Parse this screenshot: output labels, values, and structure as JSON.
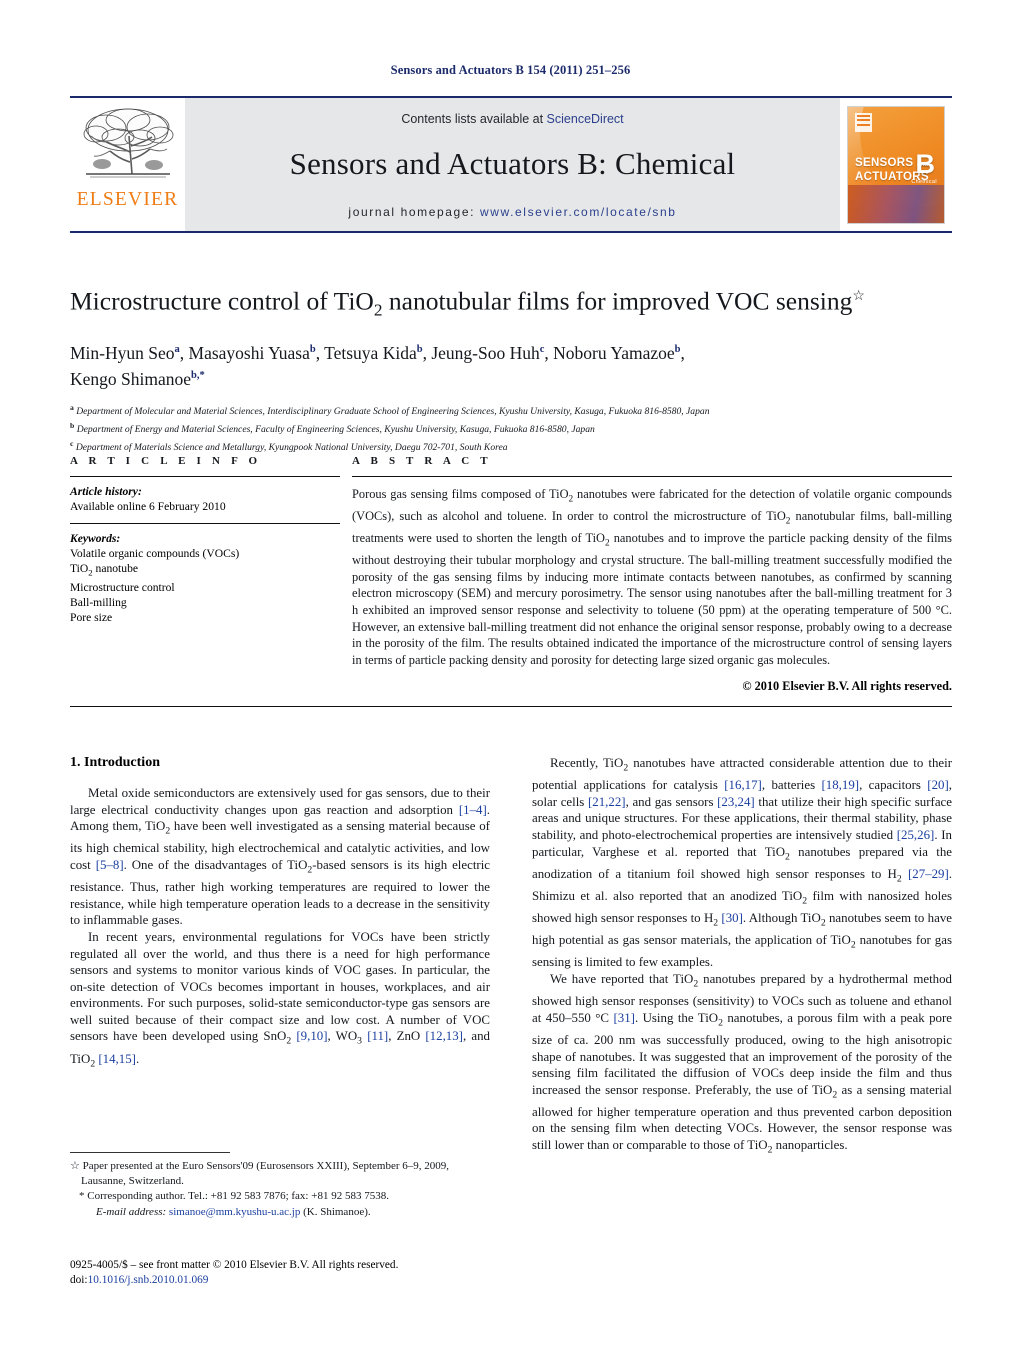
{
  "running_head": "Sensors and Actuators B 154 (2011) 251–256",
  "masthead": {
    "publisher_logo_word": "ELSEVIER",
    "contents_prefix": "Contents lists available at ",
    "contents_link": "ScienceDirect",
    "journal_title": "Sensors and Actuators B: Chemical",
    "homepage_prefix": "journal homepage: ",
    "homepage_url": "www.elsevier.com/locate/snb",
    "cover": {
      "line1": "SENSORS",
      "line1_small": "and",
      "line2": "ACTUATORS",
      "series_letter": "B",
      "series_sub": "Chemical"
    }
  },
  "title": {
    "main_part1": "Microstructure control of TiO",
    "main_sub": "2",
    "main_part2": " nanotubular films for improved VOC sensing",
    "footnote_marker": "☆"
  },
  "authors": {
    "line1": "Min-Hyun Seo a, Masayoshi Yuasa b, Tetsuya Kida b, Jeung-Soo Huh c, Noboru Yamazoe b,",
    "line2": "Kengo Shimanoe b,*"
  },
  "affiliations": [
    {
      "marker": "a",
      "text": "Department of Molecular and Material Sciences, Interdisciplinary Graduate School of Engineering Sciences, Kyushu University, Kasuga, Fukuoka 816-8580, Japan"
    },
    {
      "marker": "b",
      "text": "Department of Energy and Material Sciences, Faculty of Engineering Sciences, Kyushu University, Kasuga, Fukuoka 816-8580, Japan"
    },
    {
      "marker": "c",
      "text": "Department of Materials Science and Metallurgy, Kyungpook National University, Daegu 702-701, South Korea"
    }
  ],
  "article_info": {
    "heading": "A R T I C L E    I N F O",
    "history_label": "Article history:",
    "history_value": "Available online 6 February 2010",
    "keywords_label": "Keywords:",
    "keywords": [
      "Volatile organic compounds (VOCs)",
      "TiO2 nanotube",
      "Microstructure control",
      "Ball-milling",
      "Pore size"
    ]
  },
  "abstract": {
    "heading": "A B S T R A C T",
    "text": "Porous gas sensing films composed of TiO2 nanotubes were fabricated for the detection of volatile organic compounds (VOCs), such as alcohol and toluene. In order to control the microstructure of TiO2 nanotubular films, ball-milling treatments were used to shorten the length of TiO2 nanotubes and to improve the particle packing density of the films without destroying their tubular morphology and crystal structure. The ball-milling treatment successfully modified the porosity of the gas sensing films by inducing more intimate contacts between nanotubes, as confirmed by scanning electron microscopy (SEM) and mercury porosimetry. The sensor using nanotubes after the ball-milling treatment for 3 h exhibited an improved sensor response and selectivity to toluene (50 ppm) at the operating temperature of 500 °C. However, an extensive ball-milling treatment did not enhance the original sensor response, probably owing to a decrease in the porosity of the film. The results obtained indicated the importance of the microstructure control of sensing layers in terms of particle packing density and porosity for detecting large sized organic gas molecules.",
    "copyright": "© 2010 Elsevier B.V. All rights reserved."
  },
  "body": {
    "section1_heading": "1.  Introduction",
    "left_paragraph_1": "Metal oxide semiconductors are extensively used for gas sensors, due to their large electrical conductivity changes upon gas reaction and adsorption [1–4]. Among them, TiO2 have been well investigated as a sensing material because of its high chemical stability, high electrochemical and catalytic activities, and low cost [5–8]. One of the disadvantages of TiO2-based sensors is its high electric resistance. Thus, rather high working temperatures are required to lower the resistance, while high temperature operation leads to a decrease in the sensitivity to inflammable gases.",
    "left_paragraph_2": "In recent years, environmental regulations for VOCs have been strictly regulated all over the world, and thus there is a need for high performance sensors and systems to monitor various kinds of VOC gases. In particular, the on-site detection of VOCs becomes important in houses, workplaces, and air environments. For such purposes, solid-state semiconductor-type gas sensors are well suited because of their compact size and low cost. A number of VOC sensors have been developed using SnO2 [9,10], WO3 [11], ZnO [12,13], and TiO2 [14,15].",
    "right_paragraph_1": "Recently, TiO2 nanotubes have attracted considerable attention due to their potential applications for catalysis [16,17], batteries [18,19], capacitors [20], solar cells [21,22], and gas sensors [23,24] that utilize their high specific surface areas and unique structures. For these applications, their thermal stability, phase stability, and photo-electrochemical properties are intensively studied [25,26]. In particular, Varghese et al. reported that TiO2 nanotubes prepared via the anodization of a titanium foil showed high sensor responses to H2 [27–29]. Shimizu et al. also reported that an anodized TiO2 film with nanosized holes showed high sensor responses to H2 [30]. Although TiO2 nanotubes seem to have high potential as gas sensor materials, the application of TiO2 nanotubes for gas sensing is limited to few examples.",
    "right_paragraph_2": "We have reported that TiO2 nanotubes prepared by a hydrothermal method showed high sensor responses (sensitivity) to VOCs such as toluene and ethanol at 450–550 °C [31]. Using the TiO2 nanotubes, a porous film with a peak pore size of ca. 200 nm was successfully produced, owing to the high anisotropic shape of nanotubes. It was suggested that an improvement of the porosity of the sensing film facilitated the diffusion of VOCs deep inside the film and thus increased the sensor response. Preferably, the use of TiO2 as a sensing material allowed for higher temperature operation and thus prevented carbon deposition on the sensing film when detecting VOCs. However, the sensor response was still lower than or comparable to those of TiO2 nanoparticles."
  },
  "footnotes": {
    "star_note": "☆ Paper presented at the Euro Sensors'09 (Eurosensors XXIII), September 6–9, 2009, Lausanne, Switzerland.",
    "corresponding": "* Corresponding author. Tel.: +81 92 583 7876; fax: +81 92 583 7538.",
    "email_label": "E-mail address:",
    "email": "simanoe@mm.kyushu-u.ac.jp",
    "email_owner": "(K. Shimanoe)."
  },
  "imprint": {
    "line1": "0925-4005/$ – see front matter © 2010 Elsevier B.V. All rights reserved.",
    "doi_label": "doi:",
    "doi_value": "10.1016/j.snb.2010.01.069"
  },
  "colors": {
    "header_blue": "#1b2a6b",
    "link_blue": "#1b3fa0",
    "elsevier_orange": "#ef7c15",
    "band_grey": "#e6e7e9"
  }
}
